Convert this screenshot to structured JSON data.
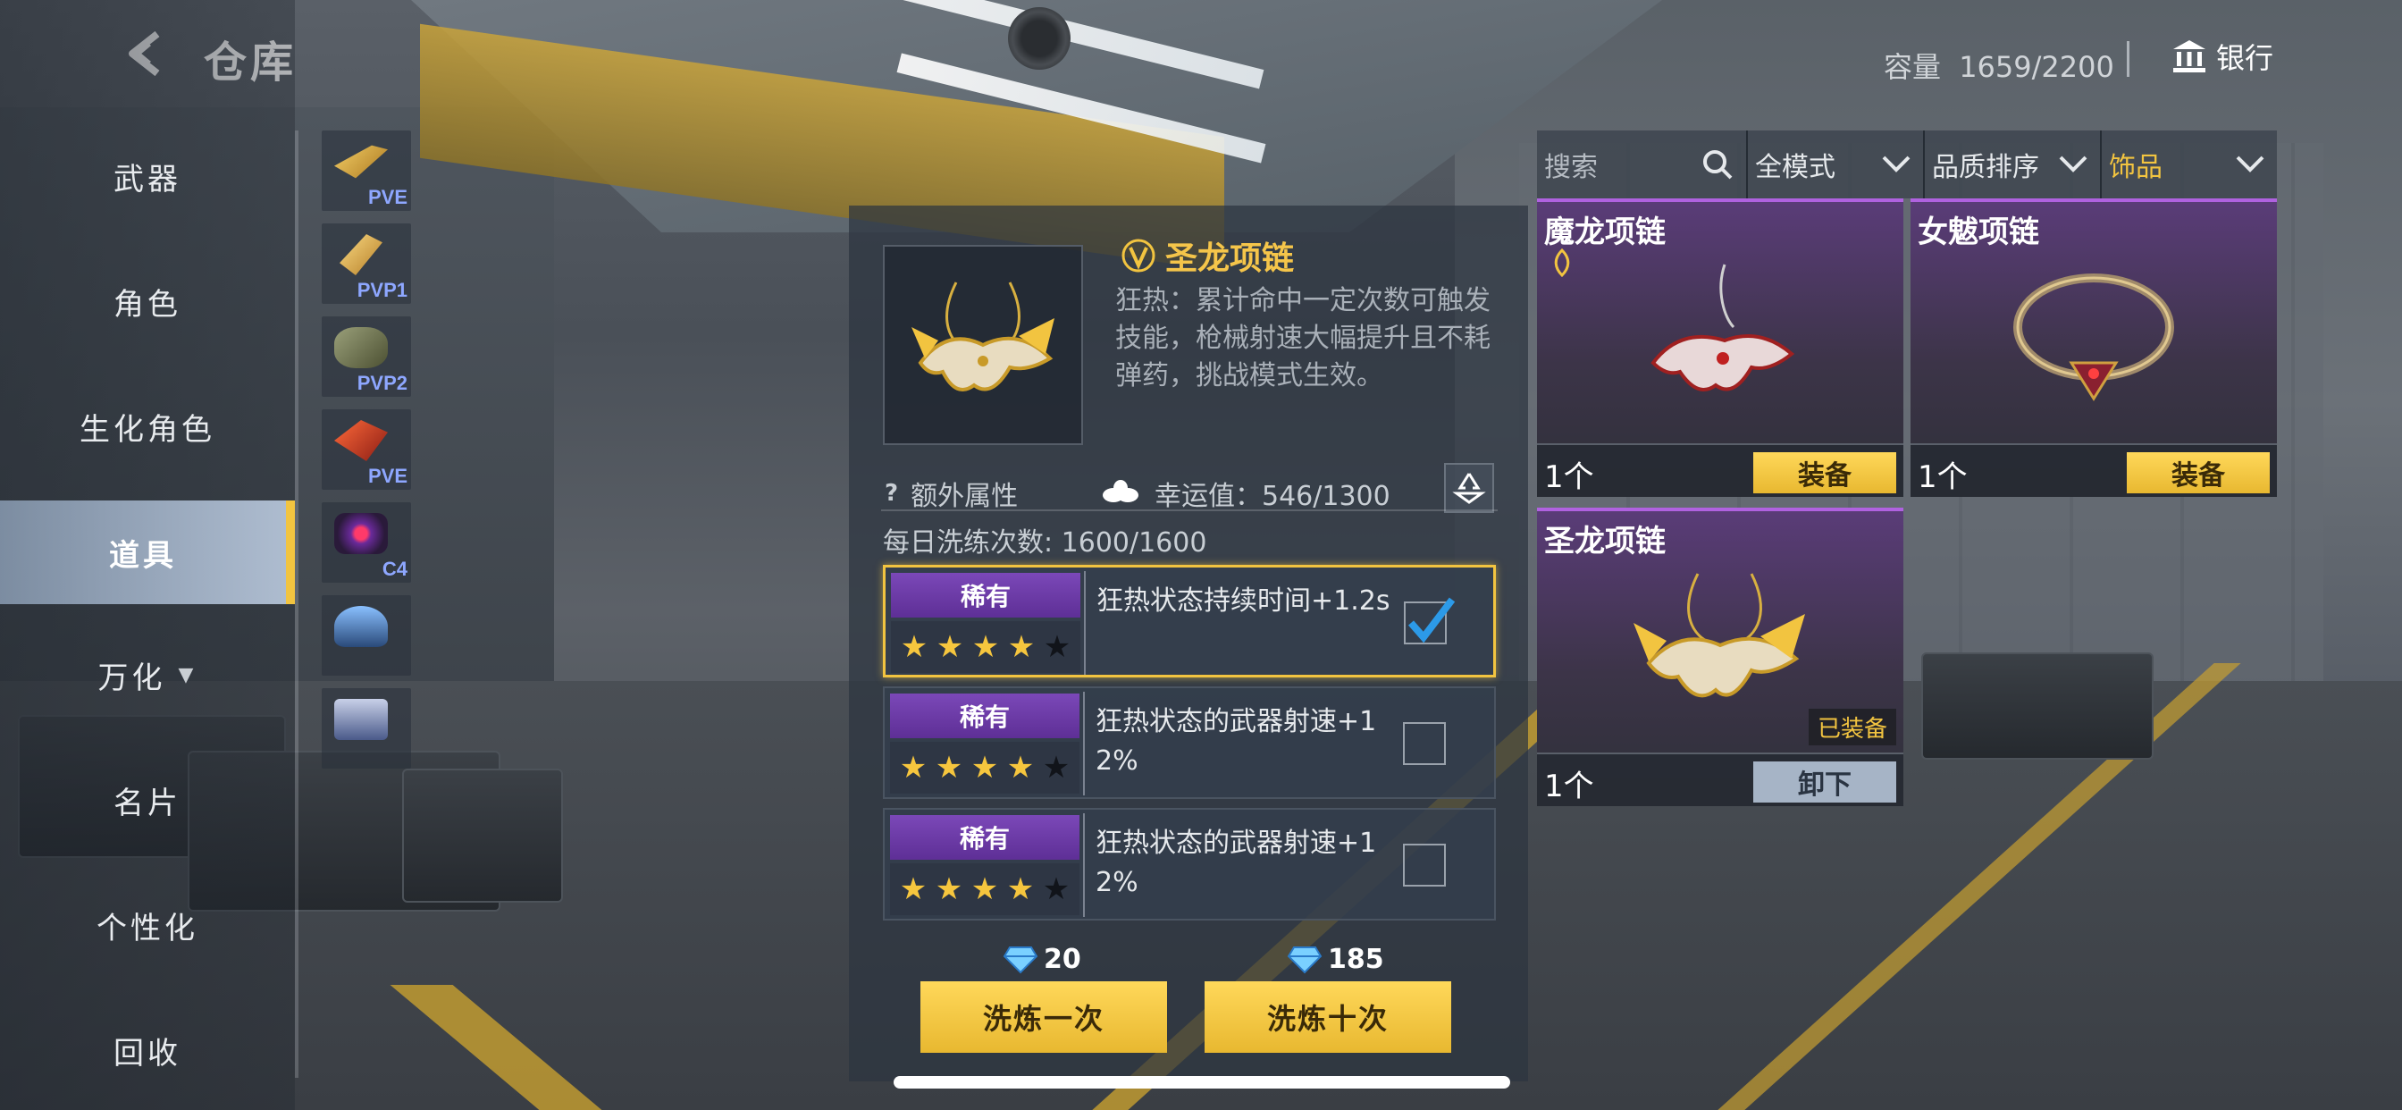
{
  "header": {
    "title": "仓库",
    "capacity_label": "容量",
    "capacity_value": "1659/2200",
    "bank_label": "银行"
  },
  "sidebar": {
    "items": [
      {
        "label": "武器"
      },
      {
        "label": "角色"
      },
      {
        "label": "生化角色"
      },
      {
        "label": "道具",
        "active": true
      },
      {
        "label": "万化"
      },
      {
        "label": "名片"
      },
      {
        "label": "个性化"
      },
      {
        "label": "回收"
      }
    ],
    "subtabs": [
      {
        "tag": "PVE",
        "icon": "golden-weapon-icon"
      },
      {
        "tag": "PVP1",
        "icon": "gold-cartridge-icon"
      },
      {
        "tag": "PVP2",
        "icon": "dog-tag-icon"
      },
      {
        "tag": "PVE",
        "icon": "red-wing-icon"
      },
      {
        "tag": "C4",
        "icon": "c4-bomb-icon"
      },
      {
        "tag": "",
        "icon": "helmet-icon"
      },
      {
        "tag": "",
        "icon": "robot-icon"
      }
    ]
  },
  "detail": {
    "name": "圣龙项链",
    "description": "狂热：累计命中一定次数可触发技能，枪械射速大幅提升且不耗弹药，挑战模式生效。",
    "extra_attr_label": "额外属性",
    "luck_label": "幸运值：546/1300",
    "daily_label": "每日洗练次数: 1600/1600",
    "rows": [
      {
        "rarity": "稀有",
        "stars_filled": 4,
        "stars_total": 5,
        "text": "狂热状态持续时间+1.2s",
        "checked": true
      },
      {
        "rarity": "稀有",
        "stars_filled": 4,
        "stars_total": 5,
        "text": "狂热状态的武器射速+12%",
        "checked": false
      },
      {
        "rarity": "稀有",
        "stars_filled": 4,
        "stars_total": 5,
        "text": "狂热状态的武器射速+12%",
        "checked": false
      }
    ],
    "cost_once": "20",
    "cost_ten": "185",
    "wash_once_label": "洗炼一次",
    "wash_ten_label": "洗炼十次"
  },
  "filters": {
    "search_placeholder": "搜索",
    "mode": "全模式",
    "sort": "品质排序",
    "category": "饰品"
  },
  "cards": [
    {
      "name": "魔龙项链",
      "qty": "1个",
      "button": "装备",
      "equipped": false
    },
    {
      "name": "女魃项链",
      "qty": "1个",
      "button": "装备",
      "equipped": false
    },
    {
      "name": "圣龙项链",
      "qty": "1个",
      "button": "卸下",
      "equipped": true,
      "equipped_label": "已装备"
    }
  ],
  "colors": {
    "accent_gold": "#f2c440",
    "rarity_purple": "#7b48b8",
    "title_gold": "#f5c54a"
  }
}
